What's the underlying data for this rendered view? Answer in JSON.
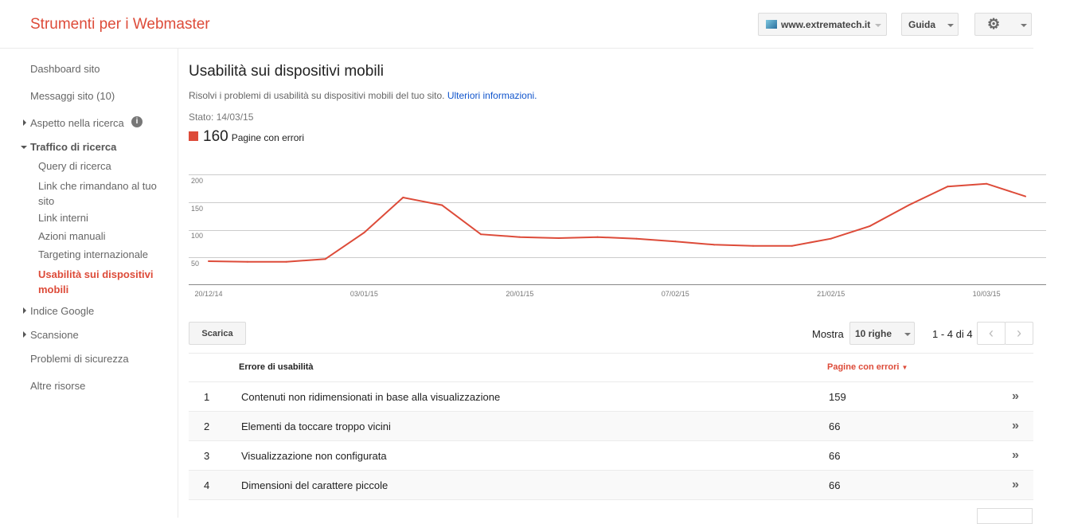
{
  "header": {
    "brand": "Strumenti per i Webmaster",
    "site": "www.extrematech.it",
    "help": "Guida",
    "settings_icon": "gear-icon"
  },
  "sidebar": {
    "items": [
      {
        "label": "Dashboard sito"
      },
      {
        "label": "Messaggi sito (10)"
      },
      {
        "label": "Aspetto nella ricerca"
      },
      {
        "label": "Traffico di ricerca"
      },
      {
        "label": "Query di ricerca"
      },
      {
        "label": "Link che rimandano al tuo sito"
      },
      {
        "label": "Link interni"
      },
      {
        "label": "Azioni manuali"
      },
      {
        "label": "Targeting internazionale"
      },
      {
        "label": "Usabilità sui dispositivi mobili"
      },
      {
        "label": "Indice Google"
      },
      {
        "label": "Scansione"
      },
      {
        "label": "Problemi di sicurezza"
      },
      {
        "label": "Altre risorse"
      }
    ]
  },
  "main": {
    "title": "Usabilità sui dispositivi mobili",
    "desc": "Risolvi i problemi di usabilità su dispositivi mobili del tuo sito.",
    "more_link": "Ulteriori informazioni.",
    "status": "Stato: 14/03/15",
    "count": "160",
    "count_label": "Pagine con errori",
    "accent": "#dd4b39"
  },
  "chart_data": {
    "type": "line",
    "series": [
      {
        "name": "Pagine con errori",
        "values": [
          42,
          41,
          41,
          46,
          94,
          158,
          144,
          91,
          86,
          84,
          86,
          83,
          78,
          72,
          70,
          70,
          83,
          106,
          144,
          178,
          183,
          160
        ]
      }
    ],
    "x_tick_labels": [
      {
        "index": 0,
        "label": "20/12/14"
      },
      {
        "index": 4,
        "label": "03/01/15"
      },
      {
        "index": 8,
        "label": "20/01/15"
      },
      {
        "index": 12,
        "label": "07/02/15"
      },
      {
        "index": 16,
        "label": "21/02/15"
      },
      {
        "index": 20,
        "label": "10/03/15"
      }
    ],
    "y_ticks": [
      50,
      100,
      150,
      200
    ],
    "ylim": [
      0,
      200
    ],
    "grid": true
  },
  "toolbar": {
    "download": "Scarica",
    "show_label": "Mostra",
    "rows_select": "10 righe",
    "range": "1 - 4 di 4"
  },
  "table": {
    "headers": {
      "error": "Errore di usabilità",
      "pages": "Pagine con errori"
    },
    "rows": [
      {
        "n": "1",
        "error": "Contenuti non ridimensionati in base alla visualizzazione",
        "pages": "159"
      },
      {
        "n": "2",
        "error": "Elementi da toccare troppo vicini",
        "pages": "66"
      },
      {
        "n": "3",
        "error": "Visualizzazione non configurata",
        "pages": "66"
      },
      {
        "n": "4",
        "error": "Dimensioni del carattere piccole",
        "pages": "66"
      }
    ],
    "go": "»"
  }
}
